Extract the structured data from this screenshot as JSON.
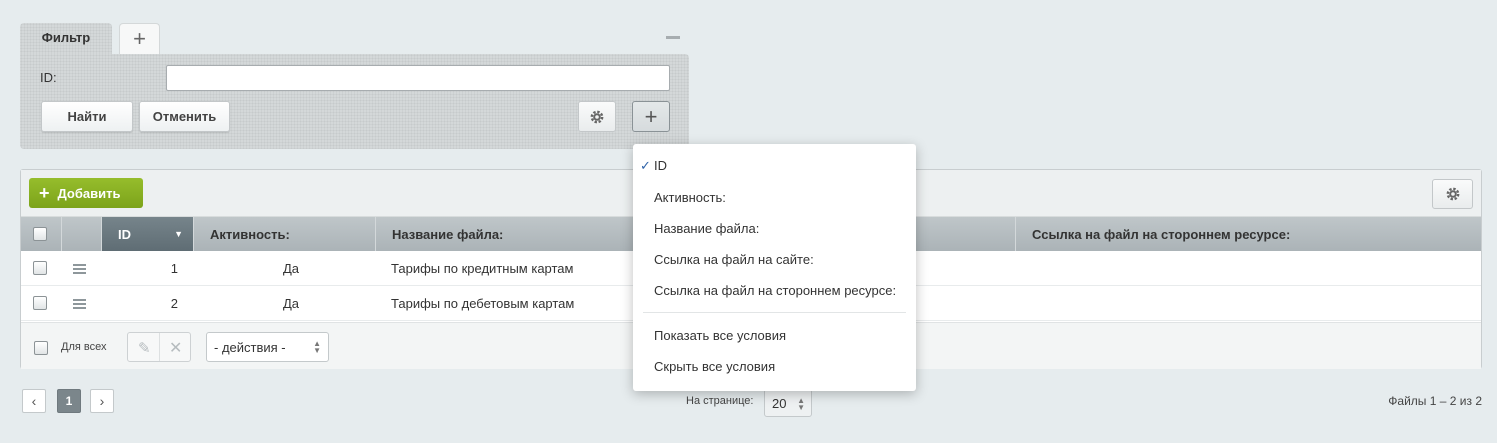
{
  "filter": {
    "tab_label": "Фильтр",
    "add_tab_icon": "plus-icon",
    "field_label": "ID:",
    "field_value": "",
    "find_button": "Найти",
    "cancel_button": "Отменить",
    "settings_icon": "gear-icon",
    "add_field_icon": "plus-icon"
  },
  "toolbar": {
    "add_button": "Добавить",
    "settings_icon": "gear-icon"
  },
  "table": {
    "columns": [
      "ID",
      "Активность:",
      "Название файла:",
      "Ссылка на файл на стороннем ресурсе:"
    ],
    "sort_indicator": "▼",
    "rows": [
      {
        "id": "1",
        "active": "Да",
        "name": "Тарифы по кредитным картам"
      },
      {
        "id": "2",
        "active": "Да",
        "name": "Тарифы по дебетовым картам"
      }
    ]
  },
  "footer": {
    "for_all_label": "Для всех",
    "actions_select": "- действия -"
  },
  "pagination": {
    "prev": "‹",
    "current_page": "1",
    "next": "›",
    "per_page_label": "На странице:",
    "per_page_value": "20",
    "summary": "Файлы 1 – 2 из 2"
  },
  "dropdown": {
    "items": [
      {
        "label": "ID",
        "checked": true
      },
      {
        "label": "Активность:",
        "checked": false
      },
      {
        "label": "Название файла:",
        "checked": false
      },
      {
        "label": "Ссылка на файл на сайте:",
        "checked": false
      },
      {
        "label": "Ссылка на файл на стороннем ресурсе:",
        "checked": false
      }
    ],
    "show_all": "Показать все условия",
    "hide_all": "Скрыть все условия"
  },
  "colors": {
    "accent_green": "#7ca31a",
    "sorted_header": "#5f6d74",
    "check_blue": "#2f63a8"
  }
}
